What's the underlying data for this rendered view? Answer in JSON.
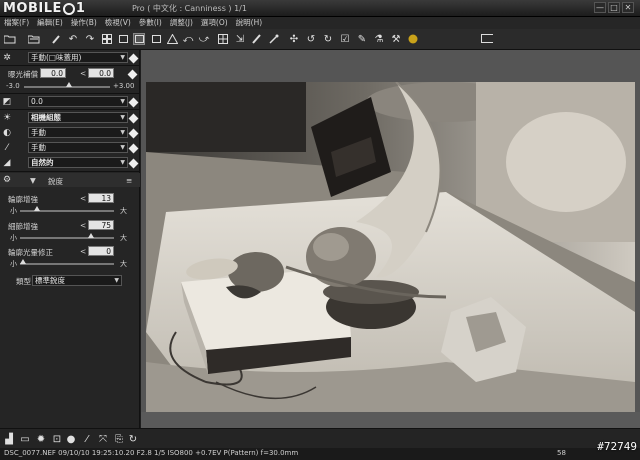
{
  "window": {
    "logo_text": "MOBILE01",
    "title": "Pro ( 中文化 : Canniness )   1/1",
    "controls": [
      "—",
      "□",
      "✕"
    ]
  },
  "menu": [
    "檔案(F)",
    "編輯(E)",
    "操作(B)",
    "檢視(V)",
    "參數(I)",
    "調整(J)",
    "選項(O)",
    "說明(H)"
  ],
  "panel": {
    "picture_control_value": "手動(□味蓋用)",
    "exposure_label": "曝光補償",
    "exposure_value_left": "0.0",
    "exposure_value_right": "0.0",
    "exposure_min": "-3.0",
    "exposure_max": "+3.00",
    "brightness_value": "0.0",
    "row_tonal": "相機組態",
    "row_manual_1": "手動",
    "row_manual_2": "手動",
    "row_picture": "自然的",
    "section_title": "銳度",
    "sharpen_label": "輪廓增強",
    "sharpen_value": "13",
    "detail_label": "細節增強",
    "detail_value": "75",
    "edge_label": "輪廓光暈修正",
    "edge_value": "0",
    "slider_small": "小",
    "slider_large": "大",
    "type_label": "類型",
    "type_value": "標準銳度"
  },
  "status": {
    "text": "DSC_0077.NEF 09/10/10 19:25:10.20 F2.8 1/5 ISO800 +0.7EV P(Pattern) f=30.0mm",
    "zoom_field": "58"
  },
  "watermark": "#72749",
  "colors": {
    "panel_bg": "#252525",
    "viewer_bg": "#555555",
    "toolbar_bg": "#2b2b2b"
  }
}
